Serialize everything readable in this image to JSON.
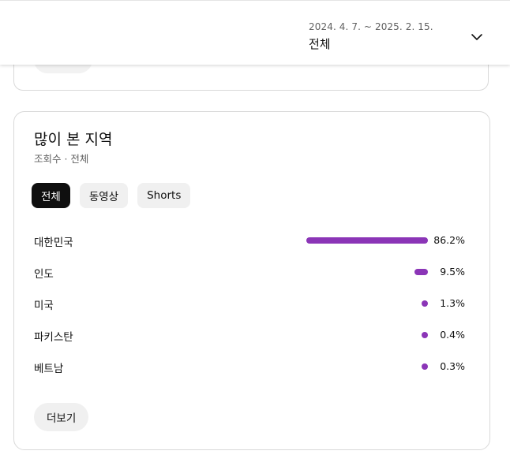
{
  "header": {
    "date_range": "2024. 4. 7. ~ 2025. 2. 15.",
    "period": "전체"
  },
  "card": {
    "title": "많이 본 지역",
    "subtitle": "조회수 · 전체",
    "chips": [
      {
        "label": "전체",
        "active": true
      },
      {
        "label": "동영상",
        "active": false
      },
      {
        "label": "Shorts",
        "active": false
      }
    ],
    "rows": [
      {
        "label": "대한민국",
        "value": "86.2%",
        "share": 86.2
      },
      {
        "label": "인도",
        "value": "9.5%",
        "share": 9.5
      },
      {
        "label": "미국",
        "value": "1.3%",
        "share": 1.3
      },
      {
        "label": "파키스탄",
        "value": "0.4%",
        "share": 0.4
      },
      {
        "label": "베트남",
        "value": "0.3%",
        "share": 0.3
      }
    ],
    "more_label": "더보기"
  },
  "colors": {
    "bar": "#8b35b7",
    "chip_active_bg": "#0f0f0f",
    "chip_bg": "#f0f0f0"
  }
}
